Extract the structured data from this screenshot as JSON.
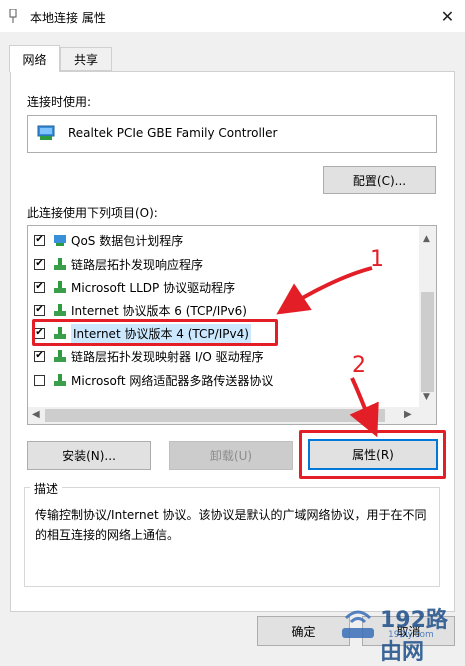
{
  "window": {
    "title": "本地连接 属性",
    "close_glyph": "✕"
  },
  "tabs": [
    {
      "label": "网络"
    },
    {
      "label": "共享"
    }
  ],
  "connect_using": {
    "label": "连接时使用:",
    "adapter": "Realtek PCIe GBE Family Controller",
    "configure_button": "配置(C)..."
  },
  "items_label": "此连接使用下列项目(O):",
  "items": [
    {
      "label": "QoS 数据包计划程序",
      "checked": true
    },
    {
      "label": "链路层拓扑发现响应程序",
      "checked": true
    },
    {
      "label": "Microsoft LLDP 协议驱动程序",
      "checked": true
    },
    {
      "label": "Internet 协议版本 6 (TCP/IPv6)",
      "checked": true
    },
    {
      "label": "Internet 协议版本 4 (TCP/IPv4)",
      "checked": true,
      "selected": true
    },
    {
      "label": "链路层拓扑发现映射器 I/O 驱动程序",
      "checked": true
    },
    {
      "label": "Microsoft 网络适配器多路传送器协议",
      "checked": false
    }
  ],
  "buttons": {
    "install": "安装(N)...",
    "uninstall": "卸载(U)",
    "properties": "属性(R)",
    "ok": "确定",
    "cancel": "取消"
  },
  "description": {
    "title": "描述",
    "text": "传输控制协议/Internet 协议。该协议是默认的广域网络协议，用于在不同的相互连接的网络上通信。"
  },
  "annotations": {
    "one": "1",
    "two": "2",
    "color": "#e41e26"
  },
  "watermark": {
    "brand": "192路由网",
    "url": "192ly.com"
  }
}
